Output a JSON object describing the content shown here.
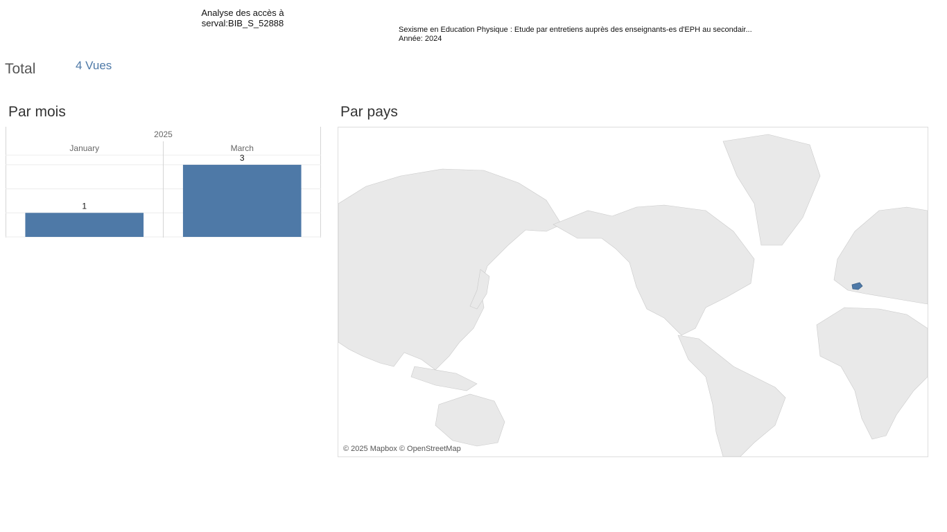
{
  "header": {
    "title_line1": "Analyse des accès à",
    "title_line2": "serval:BIB_S_52888"
  },
  "document": {
    "title": "Sexisme en Education Physique : Etude par entretiens auprès des enseignants-es d'EPH au secondair...",
    "year_line": "Année: 2024"
  },
  "total": {
    "label": "Total",
    "value": "4 Vues"
  },
  "sections": {
    "month_title": "Par mois",
    "country_title": "Par pays"
  },
  "chart_data": {
    "type": "bar",
    "year_header": "2025",
    "categories": [
      "January",
      "March"
    ],
    "values": [
      1,
      3
    ],
    "data_labels": [
      "1",
      "3"
    ],
    "ylim": [
      0,
      3.4
    ],
    "color": "#4e79a7",
    "grid": true
  },
  "map": {
    "highlighted_country": "Switzerland",
    "highlight_color": "#4e79a7",
    "land_color": "#e8e8e8",
    "attribution": "© 2025 Mapbox © OpenStreetMap"
  }
}
